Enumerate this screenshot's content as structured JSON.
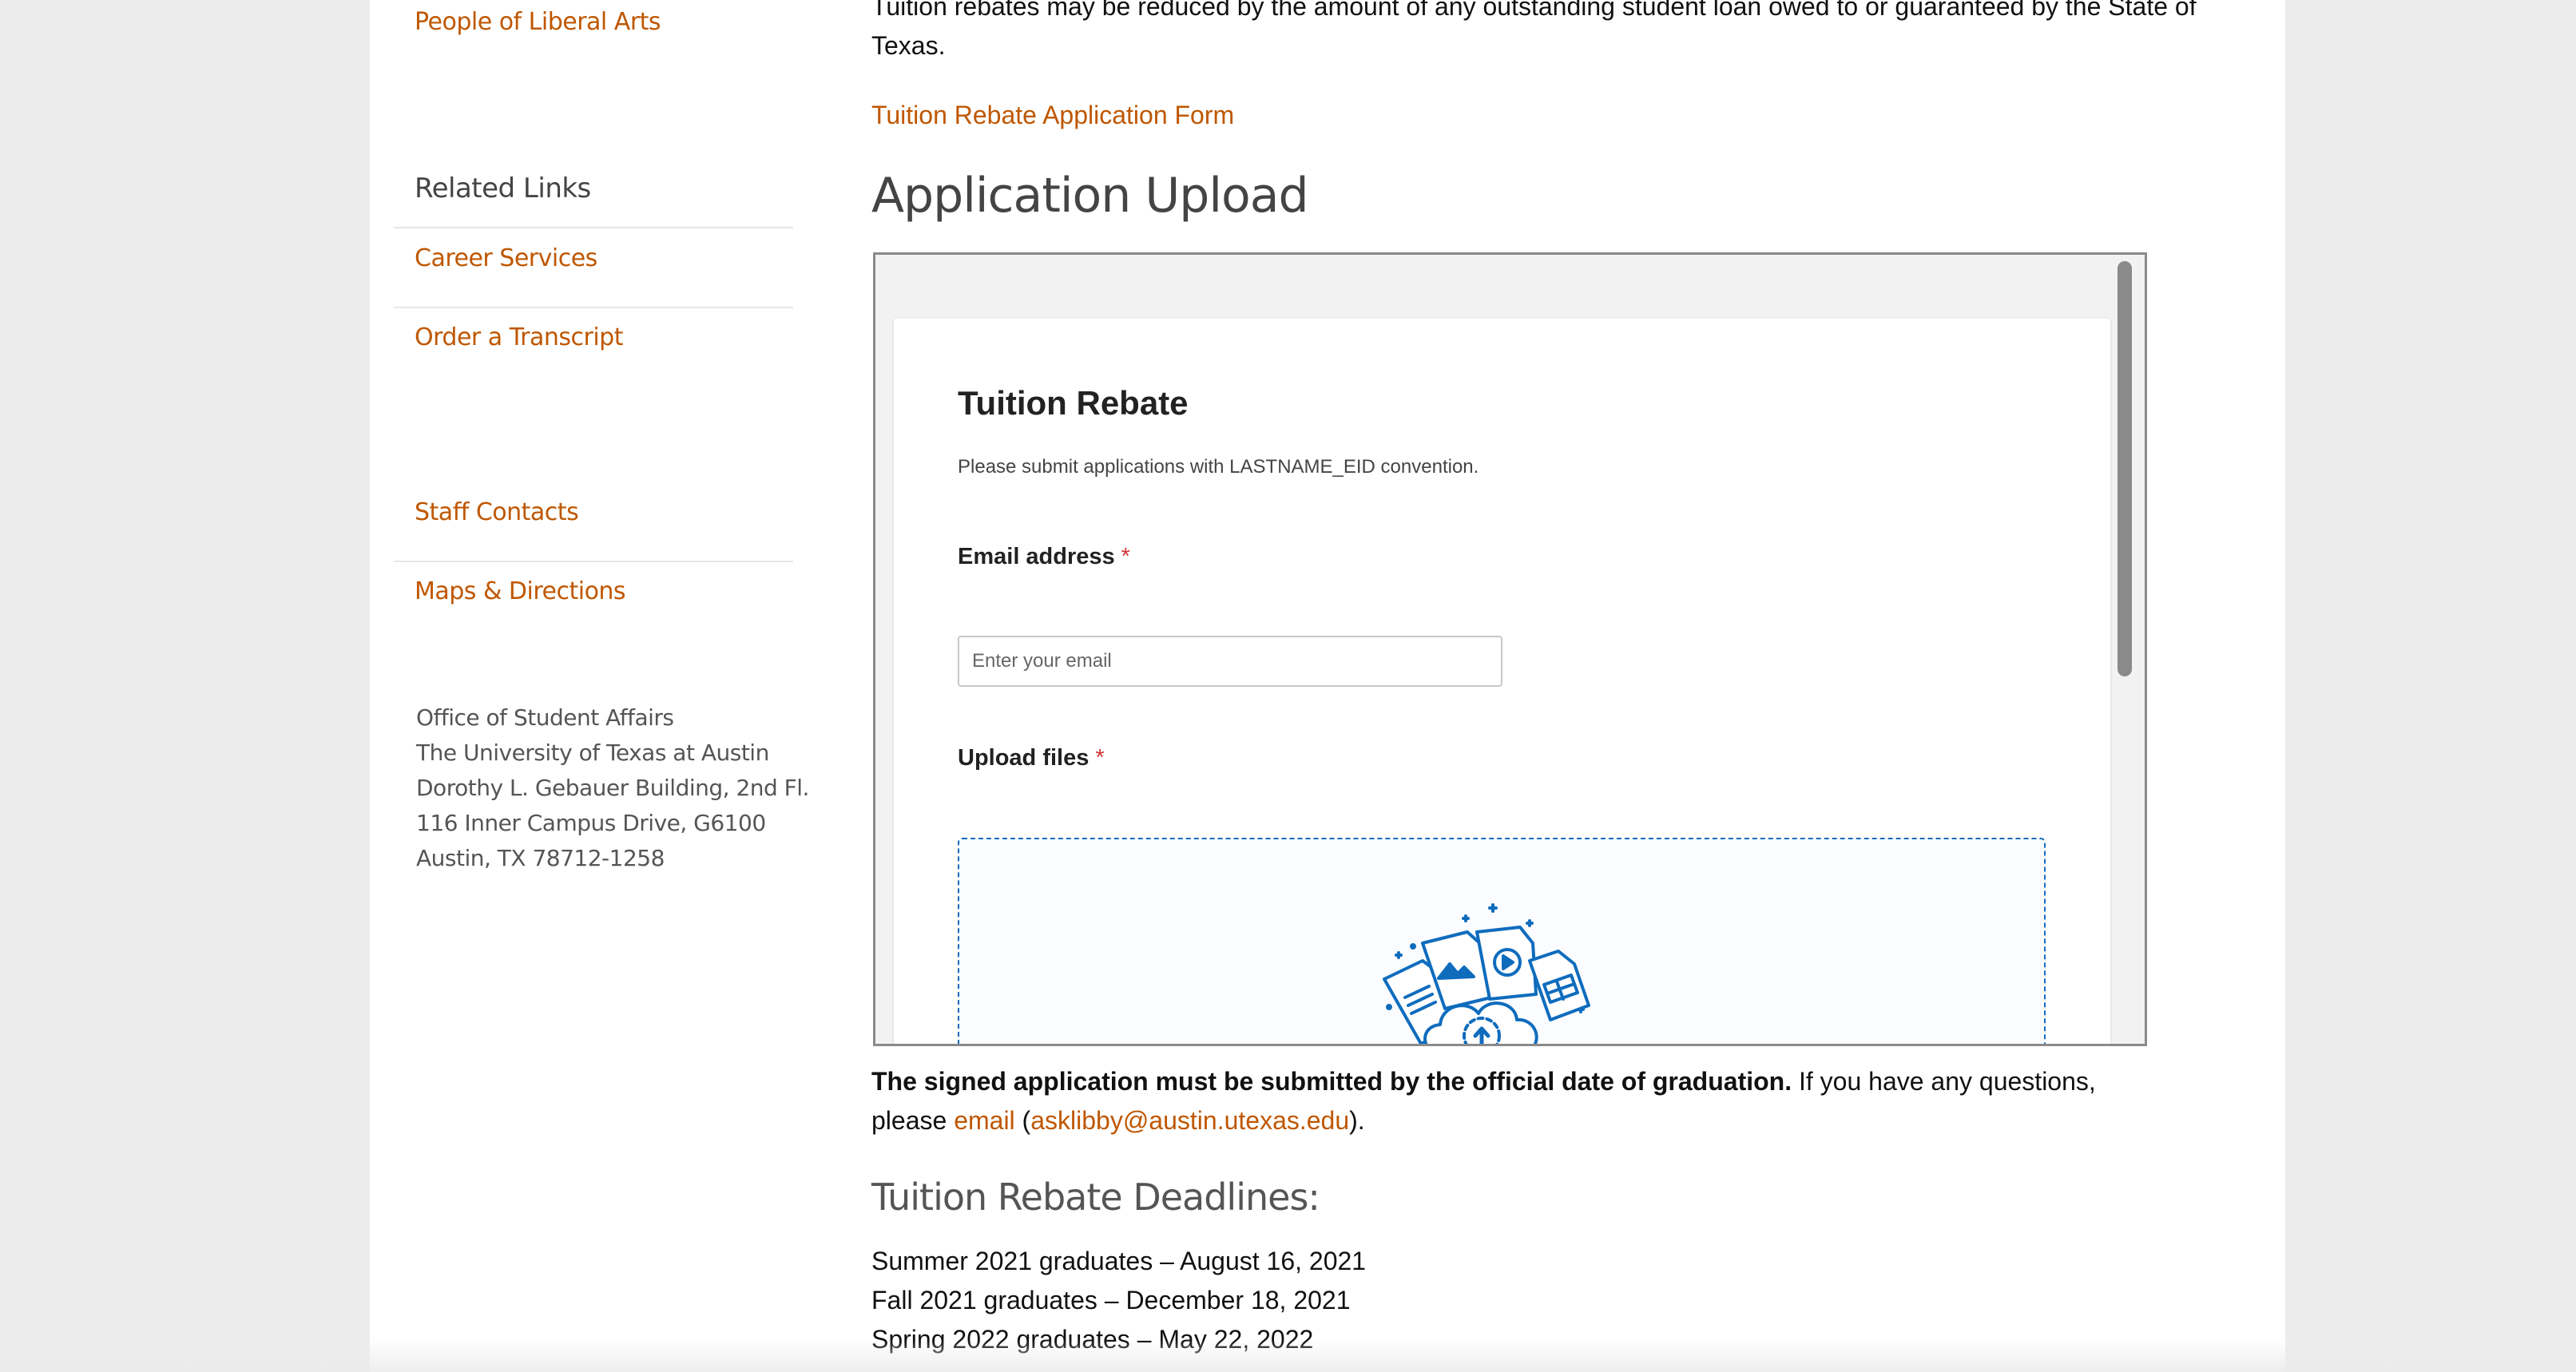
{
  "sidebar": {
    "top_link": "People of Liberal Arts",
    "related_heading": "Related Links",
    "related_links": [
      "Career Services",
      "Order a Transcript"
    ],
    "contact_links": [
      "Staff Contacts",
      "Maps & Directions"
    ],
    "address": [
      "Office of Student Affairs",
      "The University of Texas at Austin",
      "Dorothy L. Gebauer Building, 2nd Fl.",
      "116 Inner Campus Drive, G6100",
      "Austin, TX 78712-1258"
    ]
  },
  "main": {
    "intro_text_line1": "Tuition rebates may be reduced by the amount of any outstanding student loan owed to or guaranteed by the State of",
    "intro_text_line2": "Texas.",
    "form_link": "Tuition Rebate Application Form",
    "upload_heading": "Application Upload",
    "embedded_form": {
      "title": "Tuition Rebate",
      "description": "Please submit applications with LASTNAME_EID convention.",
      "email_label": "Email address",
      "email_placeholder": "Enter your email",
      "upload_label": "Upload files",
      "required_mark": "*"
    },
    "notice_bold": "The signed application must be submitted by the official date of graduation.",
    "notice_rest": " If you have any questions,",
    "notice_please": "please ",
    "email_link": "email",
    "email_open": " (",
    "email_address": "asklibby@austin.utexas.edu",
    "email_close": ").",
    "deadlines_heading": "Tuition Rebate Deadlines:",
    "deadlines": [
      "Summer 2021 graduates – August 16, 2021",
      "Fall 2021 graduates – December 18, 2021",
      "Spring 2022 graduates – May 22, 2022"
    ]
  },
  "colors": {
    "accent": "#bf5700",
    "form_accent": "#0f6cbd",
    "required": "#d13438"
  },
  "icons": {
    "upload_illustration": "cloud-upload-files-icon"
  }
}
